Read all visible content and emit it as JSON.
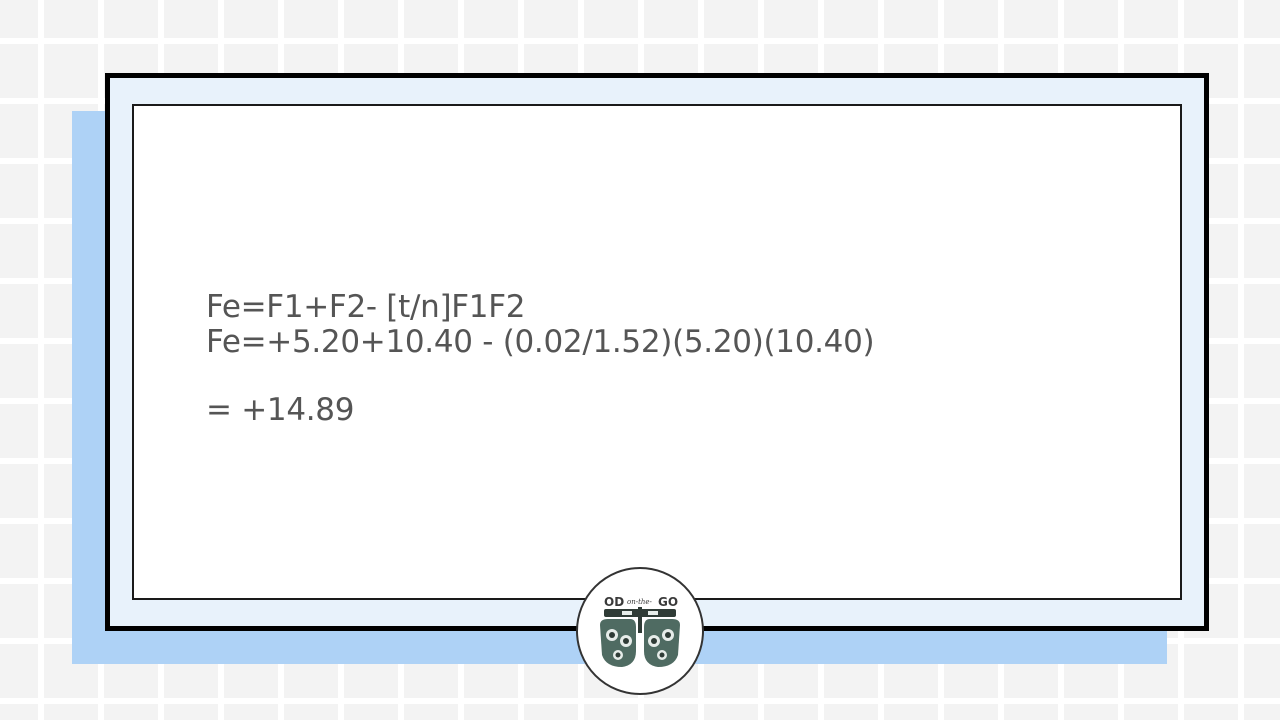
{
  "formula": {
    "line1": "Fe=F1+F2- [t/n]F1F2",
    "line2": "Fe=+5.20+10.40 - (0.02/1.52)(5.20)(10.40)",
    "result": "= +14.89"
  },
  "logo": {
    "text": "OD On-The-GO",
    "icon": "phoropter-icon"
  },
  "colors": {
    "frame_border": "#000000",
    "frame_fill": "#e8f2fb",
    "shadow_panel": "#aed2f6",
    "text": "#555555",
    "grid_bg": "#f3f3f3",
    "grid_lines": "#ffffff"
  }
}
